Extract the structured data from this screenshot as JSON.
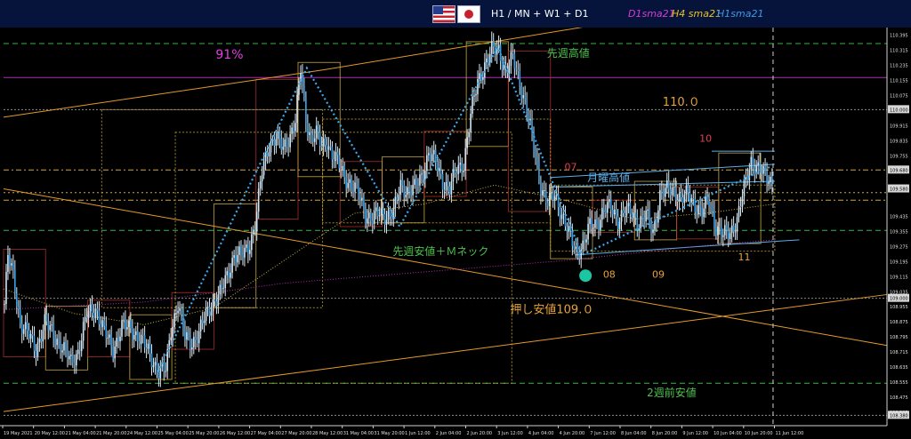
{
  "header": {
    "timeframes": "H1 / MN + W1 + D1",
    "ma_labels": [
      {
        "text": "D1sma21",
        "color": "#d63cd6"
      },
      {
        "text": "H4 sma21",
        "color": "#e8c31e"
      },
      {
        "text": "H1sma21",
        "color": "#3a9be8"
      }
    ]
  },
  "chart_data": {
    "type": "candlestick",
    "symbol": "USDJPY",
    "timeframe": "H1",
    "ylim": [
      108.325,
      110.435
    ],
    "y_ticks": [
      {
        "label": "110.395",
        "v": 110.395
      },
      {
        "label": "110.315",
        "v": 110.315
      },
      {
        "label": "110.235",
        "v": 110.235
      },
      {
        "label": "110.155",
        "v": 110.155
      },
      {
        "label": "110.075",
        "v": 110.075
      },
      {
        "label": "110.000",
        "v": 110.0,
        "boxed": true
      },
      {
        "label": "109.915",
        "v": 109.915
      },
      {
        "label": "109.835",
        "v": 109.835
      },
      {
        "label": "109.755",
        "v": 109.755
      },
      {
        "label": "109.680",
        "v": 109.68,
        "boxed": true
      },
      {
        "label": "109.595",
        "v": 109.595
      },
      {
        "label": "109.580",
        "v": 109.58,
        "boxed": true
      },
      {
        "label": "109.435",
        "v": 109.435
      },
      {
        "label": "109.355",
        "v": 109.355
      },
      {
        "label": "109.275",
        "v": 109.275
      },
      {
        "label": "109.195",
        "v": 109.195
      },
      {
        "label": "109.115",
        "v": 109.115
      },
      {
        "label": "109.035",
        "v": 109.035
      },
      {
        "label": "109.000",
        "v": 109.0,
        "boxed": true
      },
      {
        "label": "108.955",
        "v": 108.955
      },
      {
        "label": "108.875",
        "v": 108.875
      },
      {
        "label": "108.795",
        "v": 108.795
      },
      {
        "label": "108.715",
        "v": 108.715
      },
      {
        "label": "108.635",
        "v": 108.635
      },
      {
        "label": "108.555",
        "v": 108.555
      },
      {
        "label": "108.475",
        "v": 108.475
      },
      {
        "label": "108.395",
        "v": 108.395
      },
      {
        "label": "108.380",
        "v": 108.38,
        "boxed": true
      }
    ],
    "x_labels": [
      "19 May 2021",
      "20 May 12:00",
      "21 May 04:00",
      "21 May 20:00",
      "24 May 12:00",
      "25 May 04:00",
      "25 May 20:00",
      "26 May 12:00",
      "27 May 04:00",
      "27 May 20:00",
      "28 May 12:00",
      "31 May 04:00",
      "31 May 20:00",
      "1 Jun 12:00",
      "2 Jun 04:00",
      "2 Jun 20:00",
      "3 Jun 12:00",
      "4 Jun 04:00",
      "4 Jun 20:00",
      "7 Jun 12:00",
      "8 Jun 04:00",
      "8 Jun 20:00",
      "9 Jun 12:00",
      "10 Jun 04:00",
      "10 Jun 20:00",
      "11 Jun 12:00"
    ],
    "price_path": [
      {
        "t": 0,
        "v": 108.97
      },
      {
        "t": 2,
        "v": 109.22
      },
      {
        "t": 5,
        "v": 109.12
      },
      {
        "t": 9,
        "v": 108.87
      },
      {
        "t": 14,
        "v": 108.8
      },
      {
        "t": 18,
        "v": 108.73
      },
      {
        "t": 23,
        "v": 108.87
      },
      {
        "t": 28,
        "v": 108.81
      },
      {
        "t": 33,
        "v": 108.74
      },
      {
        "t": 38,
        "v": 108.66
      },
      {
        "t": 42,
        "v": 108.72
      },
      {
        "t": 47,
        "v": 108.91
      },
      {
        "t": 52,
        "v": 108.95
      },
      {
        "t": 57,
        "v": 108.82
      },
      {
        "t": 62,
        "v": 108.73
      },
      {
        "t": 67,
        "v": 108.85
      },
      {
        "t": 72,
        "v": 108.84
      },
      {
        "t": 77,
        "v": 108.79
      },
      {
        "t": 82,
        "v": 108.72
      },
      {
        "t": 88,
        "v": 108.61
      },
      {
        "t": 92,
        "v": 108.62
      },
      {
        "t": 95,
        "v": 108.84
      },
      {
        "t": 99,
        "v": 108.97
      },
      {
        "t": 103,
        "v": 108.79
      },
      {
        "t": 107,
        "v": 108.77
      },
      {
        "t": 111,
        "v": 108.81
      },
      {
        "t": 115,
        "v": 108.92
      },
      {
        "t": 119,
        "v": 108.98
      },
      {
        "t": 123,
        "v": 109.02
      },
      {
        "t": 127,
        "v": 109.12
      },
      {
        "t": 131,
        "v": 109.23
      },
      {
        "t": 135,
        "v": 109.22
      },
      {
        "t": 139,
        "v": 109.27
      },
      {
        "t": 143,
        "v": 109.39
      },
      {
        "t": 147,
        "v": 109.67
      },
      {
        "t": 151,
        "v": 109.82
      },
      {
        "t": 155,
        "v": 109.85
      },
      {
        "t": 159,
        "v": 109.79
      },
      {
        "t": 163,
        "v": 109.87
      },
      {
        "t": 166,
        "v": 109.94
      },
      {
        "t": 169,
        "v": 110.21
      },
      {
        "t": 172,
        "v": 109.95
      },
      {
        "t": 175,
        "v": 109.85
      },
      {
        "t": 178,
        "v": 109.87
      },
      {
        "t": 181,
        "v": 109.8
      },
      {
        "t": 184,
        "v": 109.84
      },
      {
        "t": 187,
        "v": 109.76
      },
      {
        "t": 190,
        "v": 109.72
      },
      {
        "t": 194,
        "v": 109.65
      },
      {
        "t": 198,
        "v": 109.6
      },
      {
        "t": 202,
        "v": 109.55
      },
      {
        "t": 206,
        "v": 109.45
      },
      {
        "t": 210,
        "v": 109.42
      },
      {
        "t": 214,
        "v": 109.45
      },
      {
        "t": 218,
        "v": 109.44
      },
      {
        "t": 222,
        "v": 109.45
      },
      {
        "t": 226,
        "v": 109.6
      },
      {
        "t": 230,
        "v": 109.57
      },
      {
        "t": 234,
        "v": 109.58
      },
      {
        "t": 238,
        "v": 109.65
      },
      {
        "t": 242,
        "v": 109.77
      },
      {
        "t": 246,
        "v": 109.72
      },
      {
        "t": 250,
        "v": 109.62
      },
      {
        "t": 254,
        "v": 109.58
      },
      {
        "t": 258,
        "v": 109.68
      },
      {
        "t": 262,
        "v": 109.72
      },
      {
        "t": 266,
        "v": 109.97
      },
      {
        "t": 270,
        "v": 110.15
      },
      {
        "t": 274,
        "v": 110.24
      },
      {
        "t": 278,
        "v": 110.31
      },
      {
        "t": 282,
        "v": 110.32
      },
      {
        "t": 286,
        "v": 110.2
      },
      {
        "t": 290,
        "v": 110.27
      },
      {
        "t": 294,
        "v": 110.15
      },
      {
        "t": 298,
        "v": 110.0
      },
      {
        "t": 302,
        "v": 109.8
      },
      {
        "t": 306,
        "v": 109.6
      },
      {
        "t": 310,
        "v": 109.5
      },
      {
        "t": 314,
        "v": 109.55
      },
      {
        "t": 318,
        "v": 109.45
      },
      {
        "t": 322,
        "v": 109.34
      },
      {
        "t": 326,
        "v": 109.25
      },
      {
        "t": 330,
        "v": 109.28
      },
      {
        "t": 334,
        "v": 109.38
      },
      {
        "t": 338,
        "v": 109.4
      },
      {
        "t": 342,
        "v": 109.47
      },
      {
        "t": 346,
        "v": 109.48
      },
      {
        "t": 350,
        "v": 109.42
      },
      {
        "t": 354,
        "v": 109.46
      },
      {
        "t": 358,
        "v": 109.45
      },
      {
        "t": 362,
        "v": 109.4
      },
      {
        "t": 366,
        "v": 109.44
      },
      {
        "t": 370,
        "v": 109.35
      },
      {
        "t": 374,
        "v": 109.55
      },
      {
        "t": 378,
        "v": 109.57
      },
      {
        "t": 382,
        "v": 109.58
      },
      {
        "t": 386,
        "v": 109.52
      },
      {
        "t": 390,
        "v": 109.55
      },
      {
        "t": 394,
        "v": 109.5
      },
      {
        "t": 398,
        "v": 109.45
      },
      {
        "t": 402,
        "v": 109.52
      },
      {
        "t": 406,
        "v": 109.38
      },
      {
        "t": 410,
        "v": 109.33
      },
      {
        "t": 414,
        "v": 109.35
      },
      {
        "t": 418,
        "v": 109.42
      },
      {
        "t": 422,
        "v": 109.58
      },
      {
        "t": 426,
        "v": 109.73
      },
      {
        "t": 430,
        "v": 109.69
      },
      {
        "t": 434,
        "v": 109.64
      },
      {
        "t": 438,
        "v": 109.62
      }
    ],
    "trendlines": [
      {
        "from": [
          0,
          109.96
        ],
        "to": [
          182,
          110.21
        ],
        "color": "#e39a2a",
        "width": 1
      },
      {
        "from": [
          182,
          110.21
        ],
        "to": [
          378,
          110.51
        ],
        "color": "#e39a2a",
        "width": 1
      },
      {
        "from": [
          0,
          109.58
        ],
        "to": [
          504,
          108.75
        ],
        "color": "#e39a2a",
        "width": 1
      },
      {
        "from": [
          0,
          108.4
        ],
        "to": [
          504,
          109.02
        ],
        "color": "#e39a2a",
        "width": 1
      },
      {
        "from": [
          312,
          109.64
        ],
        "to": [
          440,
          109.71
        ],
        "color": "#5aaee8",
        "width": 1
      },
      {
        "from": [
          312,
          109.59
        ],
        "to": [
          440,
          109.62
        ],
        "color": "#5aaee8",
        "width": 1
      },
      {
        "from": [
          326,
          109.23
        ],
        "to": [
          454,
          109.31
        ],
        "color": "#5aaee8",
        "width": 1
      },
      {
        "from": [
          404,
          109.78
        ],
        "to": [
          440,
          109.78
        ],
        "color": "#5aaee8",
        "width": 1
      }
    ],
    "zigzag": [
      {
        "t": 88,
        "v": 108.61
      },
      {
        "t": 152,
        "v": 109.82
      },
      {
        "t": 173,
        "v": 110.22
      },
      {
        "t": 226,
        "v": 109.38
      },
      {
        "t": 282,
        "v": 110.33
      },
      {
        "t": 330,
        "v": 109.23
      },
      {
        "t": 438,
        "v": 109.7
      }
    ],
    "ma_sample": [
      {
        "t": 0,
        "v": 109.05
      },
      {
        "t": 40,
        "v": 108.92
      },
      {
        "t": 80,
        "v": 108.86
      },
      {
        "t": 120,
        "v": 108.95
      },
      {
        "t": 160,
        "v": 109.2
      },
      {
        "t": 200,
        "v": 109.45
      },
      {
        "t": 240,
        "v": 109.5
      },
      {
        "t": 280,
        "v": 109.6
      },
      {
        "t": 320,
        "v": 109.52
      },
      {
        "t": 360,
        "v": 109.42
      },
      {
        "t": 400,
        "v": 109.45
      },
      {
        "t": 440,
        "v": 109.5
      }
    ],
    "d1_ma_sample": [
      {
        "t": 0,
        "v": 108.94
      },
      {
        "t": 80,
        "v": 108.98
      },
      {
        "t": 160,
        "v": 109.08
      },
      {
        "t": 240,
        "v": 109.14
      },
      {
        "t": 320,
        "v": 109.2
      },
      {
        "t": 400,
        "v": 109.28
      },
      {
        "t": 440,
        "v": 109.31
      }
    ],
    "h_lines": [
      {
        "v": 110.35,
        "color": "#3db24a",
        "dash": "6,4"
      },
      {
        "v": 110.17,
        "color": "#b12fb1",
        "dash": ""
      },
      {
        "v": 110.0,
        "color": "#8a8a8a",
        "dash": "2,2"
      },
      {
        "v": 109.68,
        "color": "#d0a64a",
        "dash": "6,3,2,3"
      },
      {
        "v": 109.56,
        "color": "#d0a64a",
        "dash": "2,3"
      },
      {
        "v": 109.52,
        "color": "#d0a64a",
        "dash": "6,3,2,3"
      },
      {
        "v": 109.36,
        "color": "#3db24a",
        "dash": "6,4"
      },
      {
        "v": 109.0,
        "color": "#8a8a8a",
        "dash": "2,2"
      },
      {
        "v": 108.55,
        "color": "#3db24a",
        "dash": "6,4"
      },
      {
        "v": 108.38,
        "color": "#8a8a8a",
        "dash": "2,2"
      }
    ],
    "annotations": [
      {
        "text": "91%",
        "color": "#e040e0",
        "t": 121,
        "v": 110.27,
        "size": 14
      },
      {
        "text": "先週高値",
        "color": "#4ec24e",
        "t": 310,
        "v": 110.28,
        "size": 12
      },
      {
        "text": "110.０",
        "color": "#e8a23a",
        "t": 376,
        "v": 110.02,
        "size": 13
      },
      {
        "text": "10",
        "color": "#e04050",
        "t": 397,
        "v": 109.83,
        "size": 11
      },
      {
        "text": "07",
        "color": "#e04050",
        "t": 320,
        "v": 109.68,
        "size": 11
      },
      {
        "text": "月曜高値",
        "color": "#5aaee8",
        "t": 333,
        "v": 109.62,
        "size": 12
      },
      {
        "text": "先週安値＋Ｍネック",
        "color": "#4ec24e",
        "t": 222,
        "v": 109.23,
        "size": 12
      },
      {
        "text": "08",
        "color": "#e8a23a",
        "t": 342,
        "v": 109.11,
        "size": 11
      },
      {
        "text": "09",
        "color": "#e8a23a",
        "t": 370,
        "v": 109.11,
        "size": 11
      },
      {
        "text": "11",
        "color": "#e8a23a",
        "t": 419,
        "v": 109.2,
        "size": 11
      },
      {
        "text": "押し安値109.０",
        "color": "#e8a23a",
        "t": 289,
        "v": 108.92,
        "size": 13
      },
      {
        "text": "2週前安値",
        "color": "#4ec24e",
        "t": 367,
        "v": 108.48,
        "size": 12
      }
    ],
    "marker": {
      "t": 332,
      "v": 109.12,
      "color": "#1dc6a2"
    },
    "vertical_dashed": [
      {
        "t": 438,
        "color": "#d0d0d0"
      }
    ],
    "grid": false,
    "legend": "none"
  }
}
